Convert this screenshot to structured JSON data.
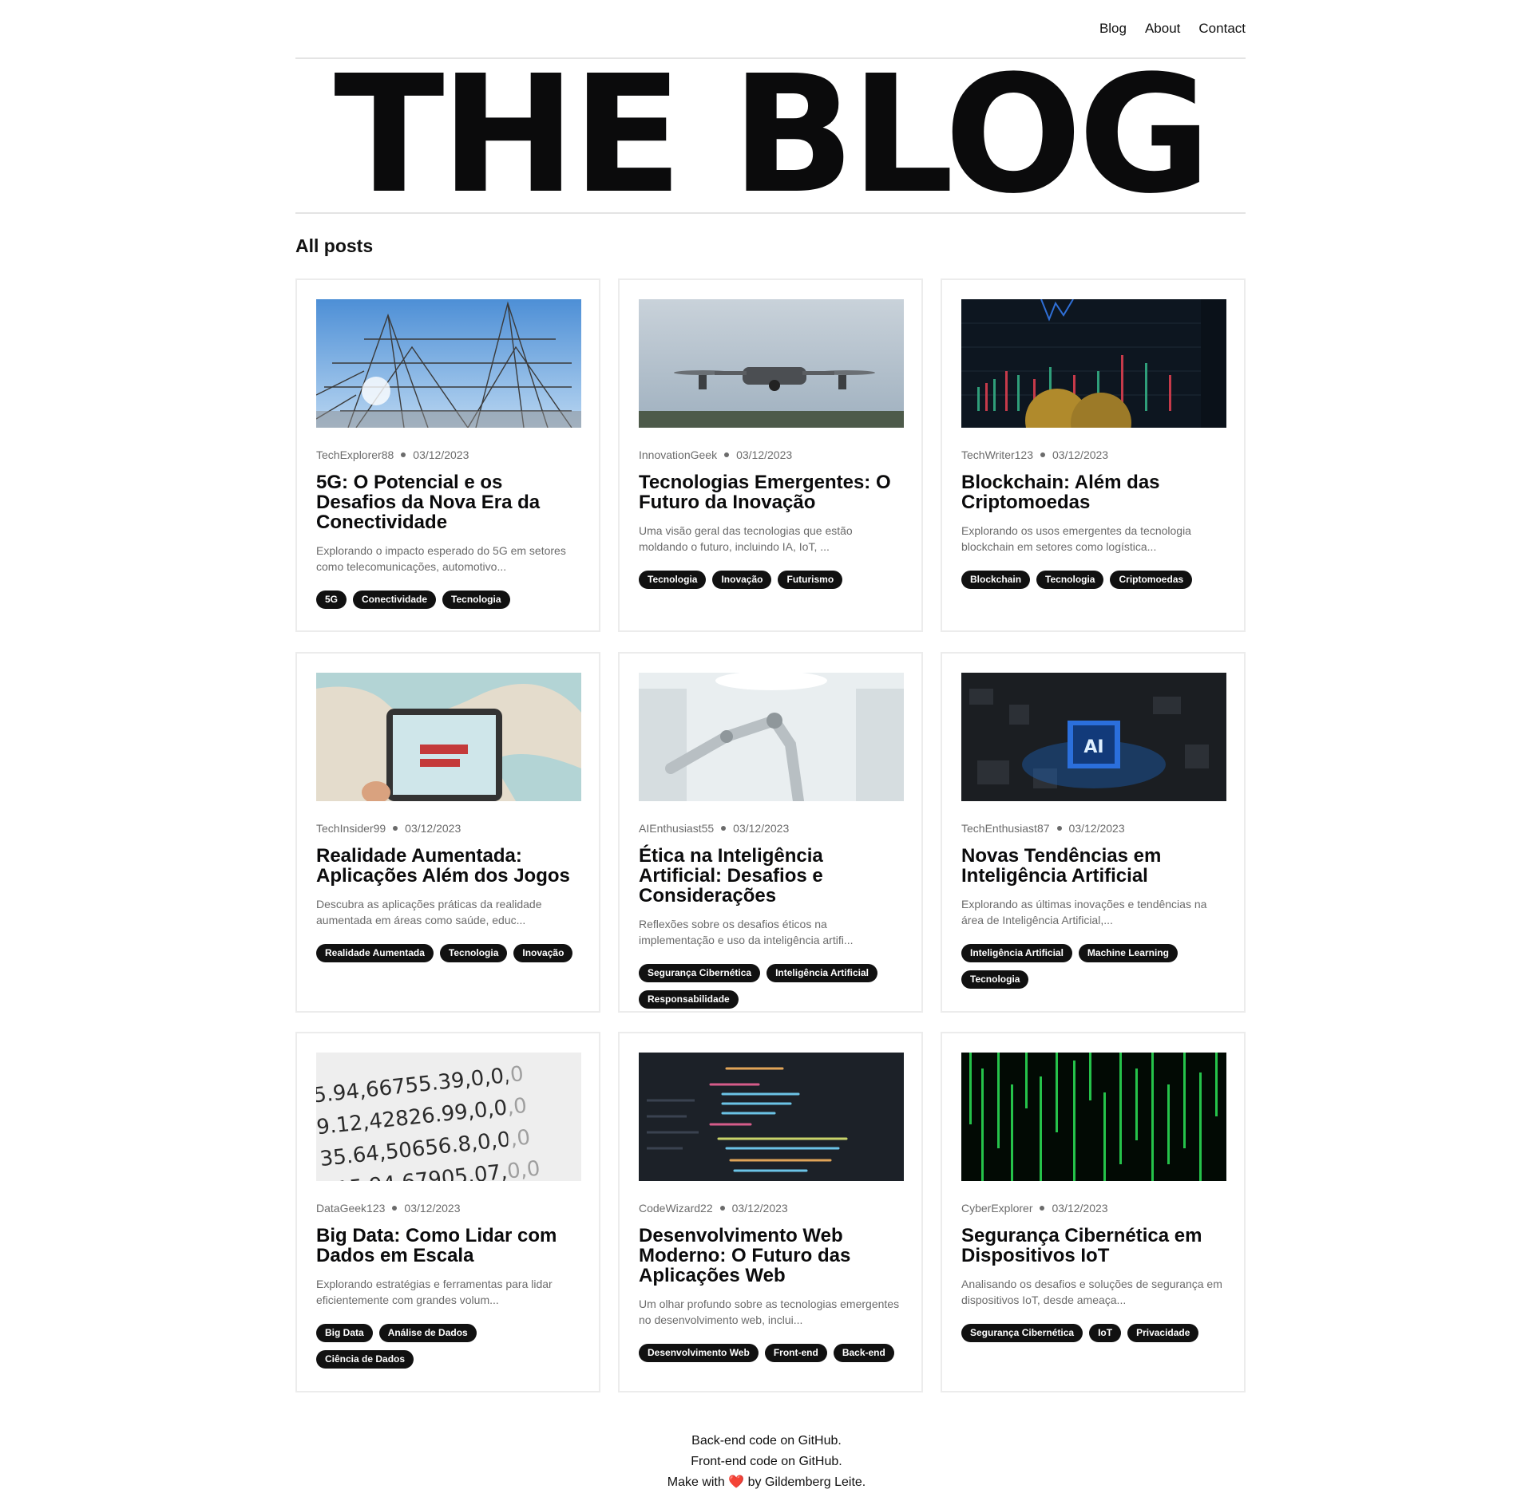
{
  "nav": {
    "blog": "Blog",
    "about": "About",
    "contact": "Contact"
  },
  "hero": {
    "title": "THE BLOG"
  },
  "section": {
    "heading": "All posts"
  },
  "posts": [
    {
      "author": "TechExplorer88",
      "date": "03/12/2023",
      "title": "5G: O Potencial e os Desafios da Nova Era da Conectividade",
      "excerpt": "Explorando o impacto esperado do 5G em setores como telecomunicações, automotivo...",
      "tags": [
        "5G",
        "Conectividade",
        "Tecnologia"
      ]
    },
    {
      "author": "InnovationGeek",
      "date": "03/12/2023",
      "title": "Tecnologias Emergentes: O Futuro da Inovação",
      "excerpt": "Uma visão geral das tecnologias que estão moldando o futuro, incluindo IA, IoT, ...",
      "tags": [
        "Tecnologia",
        "Inovação",
        "Futurismo"
      ]
    },
    {
      "author": "TechWriter123",
      "date": "03/12/2023",
      "title": "Blockchain: Além das Criptomoedas",
      "excerpt": "Explorando os usos emergentes da tecnologia blockchain em setores como logística...",
      "tags": [
        "Blockchain",
        "Tecnologia",
        "Criptomoedas"
      ]
    },
    {
      "author": "TechInsider99",
      "date": "03/12/2023",
      "title": "Realidade Aumentada: Aplicações Além dos Jogos",
      "excerpt": "Descubra as aplicações práticas da realidade aumentada em áreas como saúde, educ...",
      "tags": [
        "Realidade Aumentada",
        "Tecnologia",
        "Inovação"
      ]
    },
    {
      "author": "AIEnthusiast55",
      "date": "03/12/2023",
      "title": "Ética na Inteligência Artificial: Desafios e Considerações",
      "excerpt": "Reflexões sobre os desafios éticos na implementação e uso da inteligência artifi...",
      "tags": [
        "Segurança Cibernética",
        "Inteligência Artificial",
        "Responsabilidade"
      ]
    },
    {
      "author": "TechEnthusiast87",
      "date": "03/12/2023",
      "title": "Novas Tendências em Inteligência Artificial",
      "excerpt": "Explorando as últimas inovações e tendências na área de Inteligência Artificial,...",
      "tags": [
        "Inteligência Artificial",
        "Machine Learning",
        "Tecnologia"
      ]
    },
    {
      "author": "DataGeek123",
      "date": "03/12/2023",
      "title": "Big Data: Como Lidar com Dados em Escala",
      "excerpt": "Explorando estratégias e ferramentas para lidar eficientemente com grandes volum...",
      "tags": [
        "Big Data",
        "Análise de Dados",
        "Ciência de Dados"
      ]
    },
    {
      "author": "CodeWizard22",
      "date": "03/12/2023",
      "title": "Desenvolvimento Web Moderno: O Futuro das Aplicações Web",
      "excerpt": "Um olhar profundo sobre as tecnologias emergentes no desenvolvimento web, inclui...",
      "tags": [
        "Desenvolvimento Web",
        "Front-end",
        "Back-end"
      ]
    },
    {
      "author": "CyberExplorer",
      "date": "03/12/2023",
      "title": "Segurança Cibernética em Dispositivos IoT",
      "excerpt": "Analisando os desafios e soluções de segurança em dispositivos IoT, desde ameaça...",
      "tags": [
        "Segurança Cibernética",
        "IoT",
        "Privacidade"
      ]
    }
  ],
  "footer": {
    "backend": "Back-end code on GitHub.",
    "frontend": "Front-end code on GitHub.",
    "made_prefix": "Make with",
    "heart": "❤️",
    "made_suffix": "by Gildemberg Leite."
  }
}
